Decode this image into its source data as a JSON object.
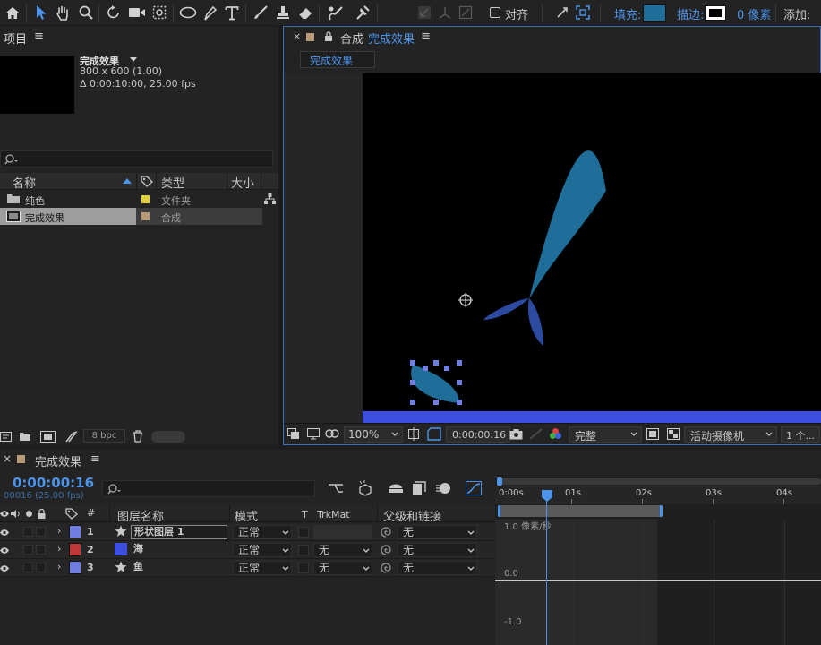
{
  "toolbar": {
    "align_label": "对齐",
    "fill_label": "填充:",
    "stroke_label": "描边:",
    "stroke_width": "0 像素",
    "add_label": "添加:",
    "fill_color": "#1f6e99",
    "accent_color": "#4c94ea"
  },
  "project": {
    "panel_title": "项目",
    "menu_icon": "≡",
    "comp_name": "完成效果",
    "comp_size": "800 x 600 (1.00)",
    "comp_duration": "Δ 0:00:10:00, 25.00 fps",
    "columns": {
      "name": "名称",
      "type": "类型",
      "size": "大小"
    },
    "items": [
      {
        "name": "纯色",
        "type": "文件夹",
        "color": "#e0d040"
      },
      {
        "name": "完成效果",
        "type": "合成",
        "color": "#b89a76"
      }
    ],
    "bpc": "8 bpc"
  },
  "viewer": {
    "panel_label": "合成",
    "comp_name": "完成效果",
    "tab_label": "完成效果",
    "zoom": "100%",
    "timecode": "0:00:00:16",
    "resolution": "完整",
    "camera": "活动摄像机",
    "views": "1 个..."
  },
  "timeline": {
    "panel_title": "完成效果",
    "timecode": "0:00:00:16",
    "frame_info": "00016 (25.00 fps)",
    "columns": {
      "hash": "#",
      "layer_name": "图层名称",
      "mode": "模式",
      "t": "T",
      "trkmat": "TrkMat",
      "parent": "父级和链接"
    },
    "layers": [
      {
        "index": "1",
        "name": "形状图层 1",
        "color": "#6f7ee0",
        "mode": "正常",
        "trkmat": "",
        "parent": "无",
        "is_star": true
      },
      {
        "index": "2",
        "name": "海",
        "color": "#c03838",
        "mode": "正常",
        "trkmat": "无",
        "parent": "无",
        "is_star": false
      },
      {
        "index": "3",
        "name": "鱼",
        "color": "#6f7ee0",
        "mode": "正常",
        "trkmat": "无",
        "parent": "无",
        "is_star": true
      }
    ],
    "ruler": [
      "0:00s",
      "01s",
      "02s",
      "03s",
      "04s"
    ],
    "graph": {
      "top_label": "1.0 像素/秒",
      "mid_label": "0.0",
      "bottom_label": "-1.0"
    }
  }
}
